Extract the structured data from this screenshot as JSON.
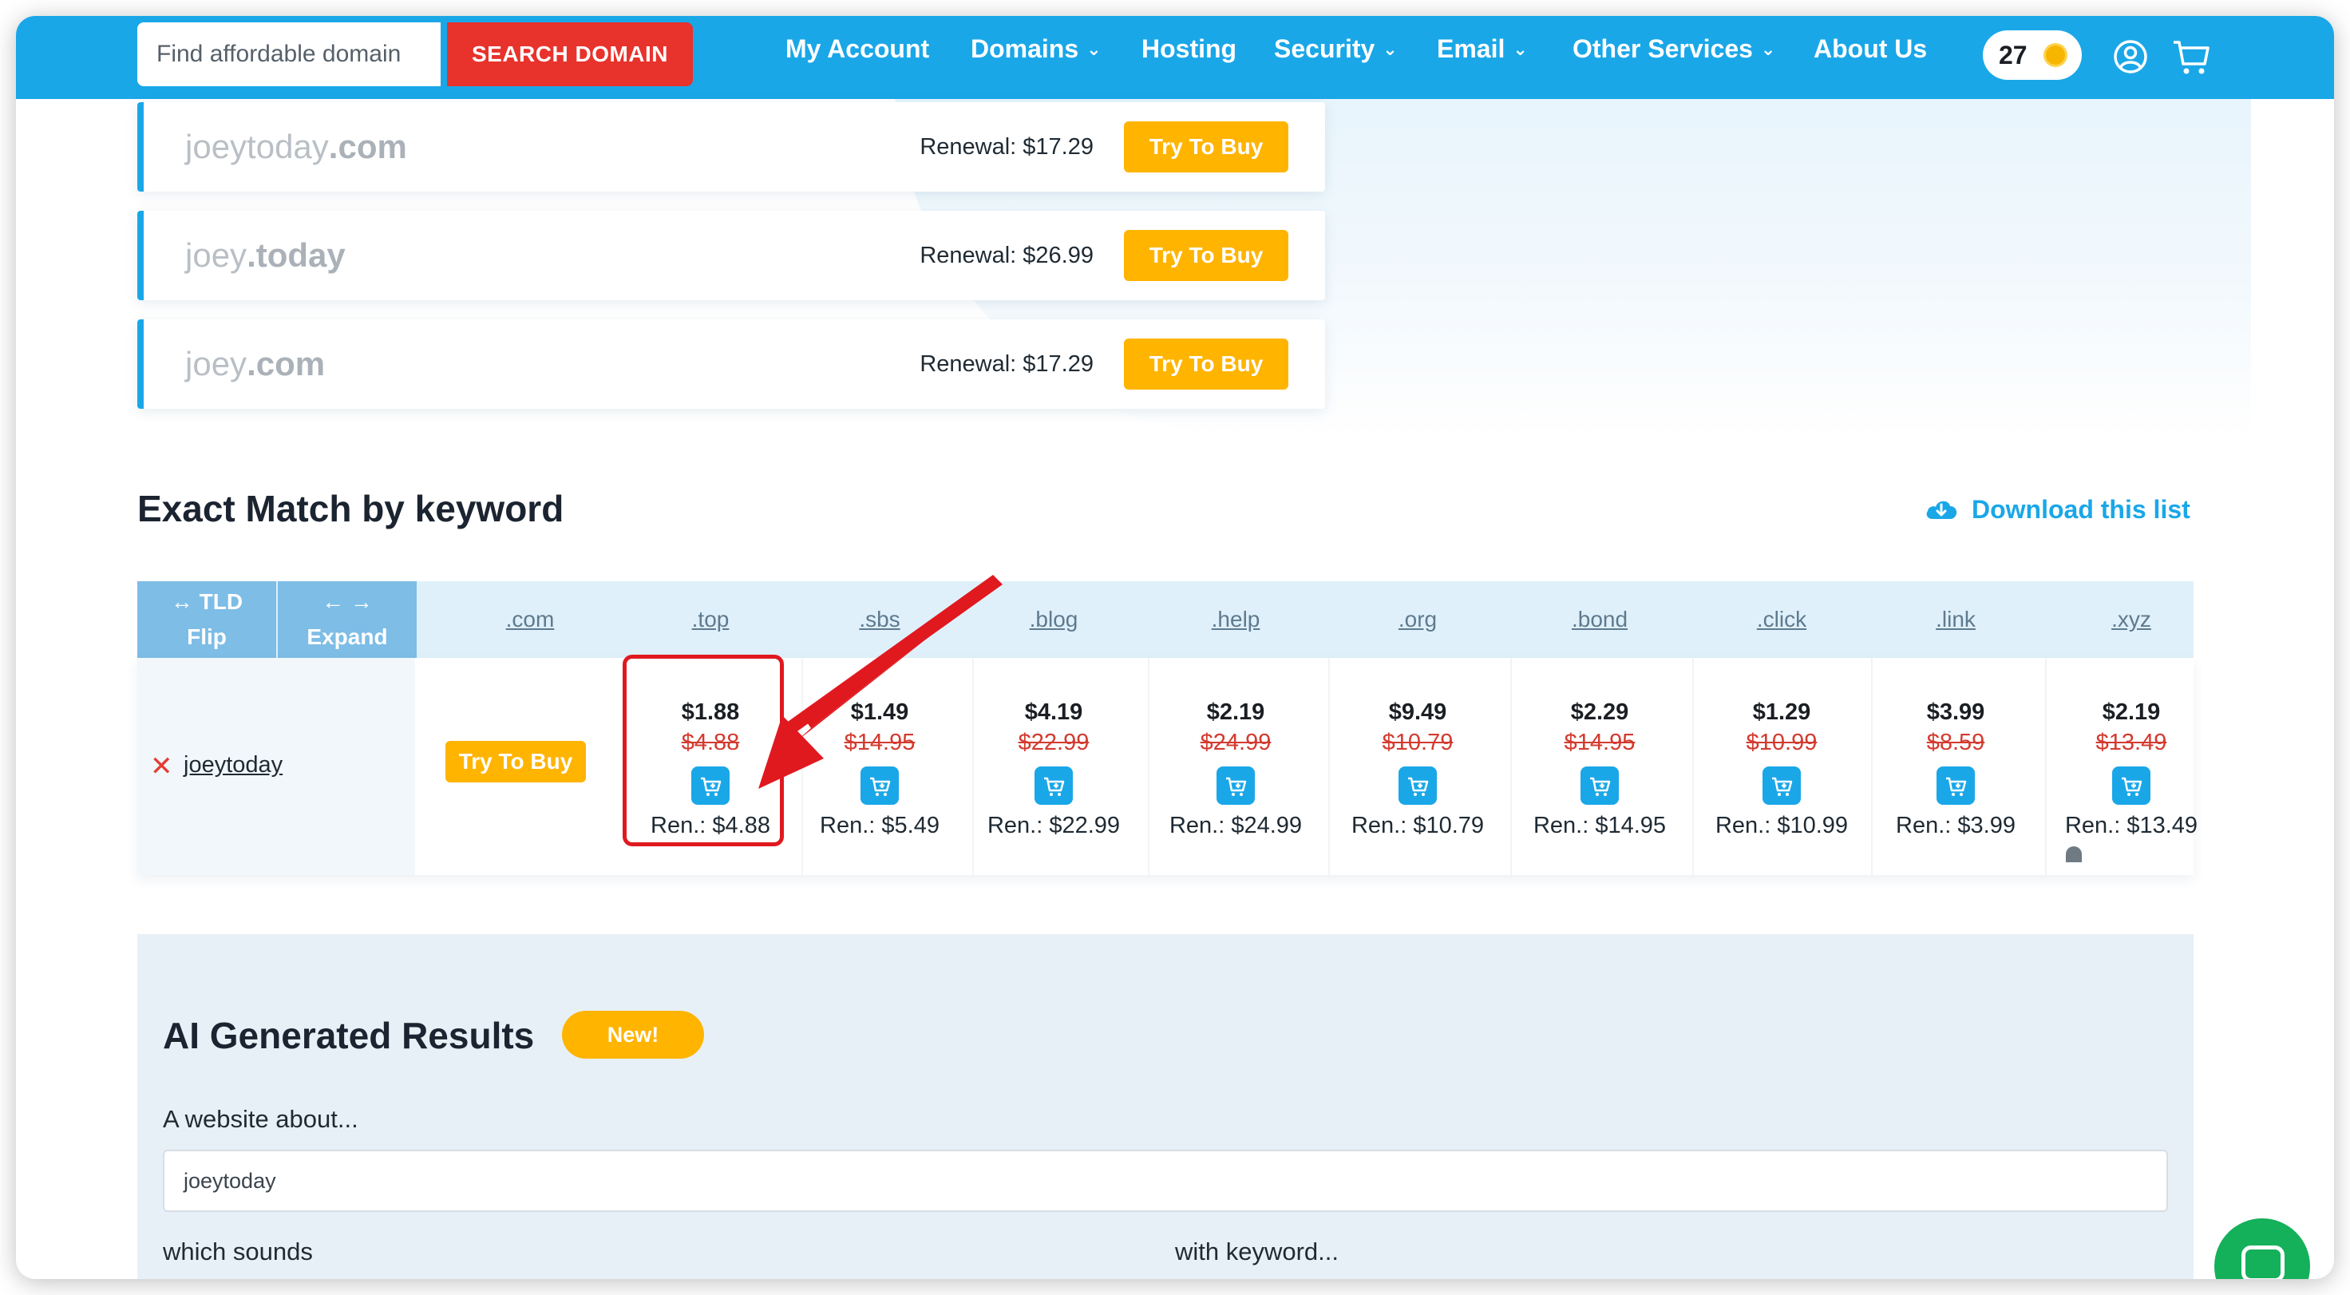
{
  "header": {
    "search_placeholder": "Find affordable domain",
    "search_button": "SEARCH DOMAIN",
    "nav": [
      {
        "label": "My Account",
        "dropdown": false
      },
      {
        "label": "Domains",
        "dropdown": true
      },
      {
        "label": "Hosting",
        "dropdown": false
      },
      {
        "label": "Security",
        "dropdown": true
      },
      {
        "label": "Email",
        "dropdown": true
      },
      {
        "label": "Other Services",
        "dropdown": true
      },
      {
        "label": "About Us",
        "dropdown": false
      }
    ],
    "coin_count": "27",
    "icons": [
      "coin-icon",
      "user-icon",
      "cart-icon"
    ]
  },
  "domain_rows": [
    {
      "sld": "joeytoday",
      "tld": ".com",
      "renewal": "Renewal: $17.29",
      "button": "Try To Buy"
    },
    {
      "sld": "joey",
      "tld": ".today",
      "renewal": "Renewal: $26.99",
      "button": "Try To Buy"
    },
    {
      "sld": "joey",
      "tld": ".com",
      "renewal": "Renewal: $17.29",
      "button": "Try To Buy"
    }
  ],
  "exact_match": {
    "title": "Exact Match by keyword",
    "download_label": "Download this list",
    "flip_label": {
      "icon": "↔",
      "line1": "TLD",
      "line2": "Flip"
    },
    "expand_label": {
      "icon": "← →",
      "line1": "",
      "line2": "Expand"
    },
    "keyword": "joeytoday",
    "com_button": "Try To Buy",
    "tlds": [
      ".com",
      ".top",
      ".sbs",
      ".blog",
      ".help",
      ".org",
      ".bond",
      ".click",
      ".link",
      ".xyz"
    ],
    "prices": [
      {
        "tld": ".top",
        "price": "$1.88",
        "old": "$4.88",
        "renewal": "Ren.: $4.88"
      },
      {
        "tld": ".sbs",
        "price": "$1.49",
        "old": "$14.95",
        "renewal": "Ren.: $5.49"
      },
      {
        "tld": ".blog",
        "price": "$4.19",
        "old": "$22.99",
        "renewal": "Ren.: $22.99"
      },
      {
        "tld": ".help",
        "price": "$2.19",
        "old": "$24.99",
        "renewal": "Ren.: $24.99"
      },
      {
        "tld": ".org",
        "price": "$9.49",
        "old": "$10.79",
        "renewal": "Ren.: $10.79"
      },
      {
        "tld": ".bond",
        "price": "$2.29",
        "old": "$14.95",
        "renewal": "Ren.: $14.95"
      },
      {
        "tld": ".click",
        "price": "$1.29",
        "old": "$10.99",
        "renewal": "Ren.: $10.99"
      },
      {
        "tld": ".link",
        "price": "$3.99",
        "old": "$8.59",
        "renewal": "Ren.: $3.99"
      },
      {
        "tld": ".xyz",
        "price": "$2.19",
        "old": "$13.49",
        "renewal": "Ren.: $13.49"
      }
    ]
  },
  "ai": {
    "title": "AI Generated Results",
    "badge": "New!",
    "about_label": "A website about...",
    "about_value": "joeytoday",
    "sounds_label": "which sounds",
    "keyword_label": "with keyword..."
  },
  "colors": {
    "brand": "#1aa7e8",
    "search_button": "#e8322c",
    "buy_button": "#ffb400",
    "highlight": "#e0191f"
  }
}
